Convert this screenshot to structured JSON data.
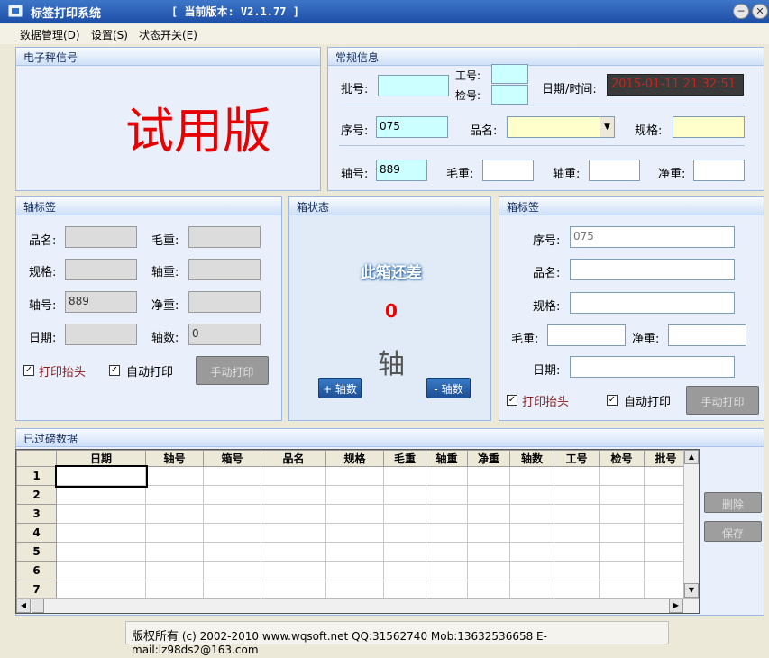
{
  "window": {
    "title": "标签打印系统",
    "version": "[ 当前版本: V2.1.77 ]"
  },
  "menu": [
    "数据管理(D)",
    "设置(S)",
    "状态开关(E)"
  ],
  "scale_panel": {
    "title": "电子秤信号",
    "watermark": "试用版"
  },
  "general": {
    "title": "常规信息",
    "batch_label": "批号:",
    "batch_value": "",
    "worker_label": "工号:",
    "worker_value": "",
    "inspector_label": "检号:",
    "inspector_value": "",
    "datetime_label": "日期/时间:",
    "datetime_value": "2015-01-11  21:32:51",
    "serial_label": "序号:",
    "serial_value": "075",
    "product_label": "品名:",
    "product_value": "",
    "spec_label": "规格:",
    "spec_value": "",
    "axis_label": "轴号:",
    "axis_value": "889",
    "gross_label": "毛重:",
    "gross_value": "",
    "axis_weight_label": "轴重:",
    "axis_weight_value": "",
    "net_label": "净重:",
    "net_value": ""
  },
  "axis_label_panel": {
    "title": "轴标签",
    "product_label": "品名:",
    "product_value": "",
    "gross_label": "毛重:",
    "gross_value": "",
    "spec_label": "规格:",
    "spec_value": "",
    "axis_weight_label": "轴重:",
    "axis_weight_value": "",
    "axis_no_label": "轴号:",
    "axis_no_value": "889",
    "net_label": "净重:",
    "net_value": "",
    "date_label": "日期:",
    "date_value": "",
    "axis_count_label": "轴数:",
    "axis_count_value": "0",
    "print_header_label": "打印抬头",
    "print_header_checked": true,
    "auto_print_label": "自动打印",
    "auto_print_checked": true,
    "manual_print_label": "手动打印"
  },
  "box_status": {
    "title": "箱状态",
    "status_text": "此箱还差",
    "count": "0",
    "unit": "轴",
    "plus_label": "+ 轴数",
    "minus_label": "- 轴数"
  },
  "box_label_panel": {
    "title": "箱标签",
    "serial_label": "序号:",
    "serial_value": "075",
    "product_label": "品名:",
    "product_value": "",
    "spec_label": "规格:",
    "spec_value": "",
    "gross_label": "毛重:",
    "gross_value": "",
    "net_label": "净重:",
    "net_value": "",
    "date_label": "日期:",
    "date_value": "",
    "print_header_label": "打印抬头",
    "print_header_checked": true,
    "auto_print_label": "自动打印",
    "auto_print_checked": true,
    "manual_print_label": "手动打印"
  },
  "weighed_data": {
    "title": "已过磅数据",
    "columns": [
      "日期",
      "轴号",
      "箱号",
      "品名",
      "规格",
      "毛重",
      "轴重",
      "净重",
      "轴数",
      "工号",
      "检号",
      "批号"
    ],
    "row_numbers": [
      "1",
      "2",
      "3",
      "4",
      "5",
      "6",
      "7"
    ],
    "delete_label": "删除",
    "save_label": "保存"
  },
  "footer": {
    "copyright": "版权所有",
    "info": "(c) 2002-2010 www.wqsoft.net QQ:31562740 Mob:13632536658 E-mail:lz98ds2@163.com"
  },
  "colors": {
    "accent": "#1e4fa7",
    "watermark": "#e60000",
    "datetime_bg": "#3a3a3a",
    "datetime_fg": "#c8241c"
  }
}
